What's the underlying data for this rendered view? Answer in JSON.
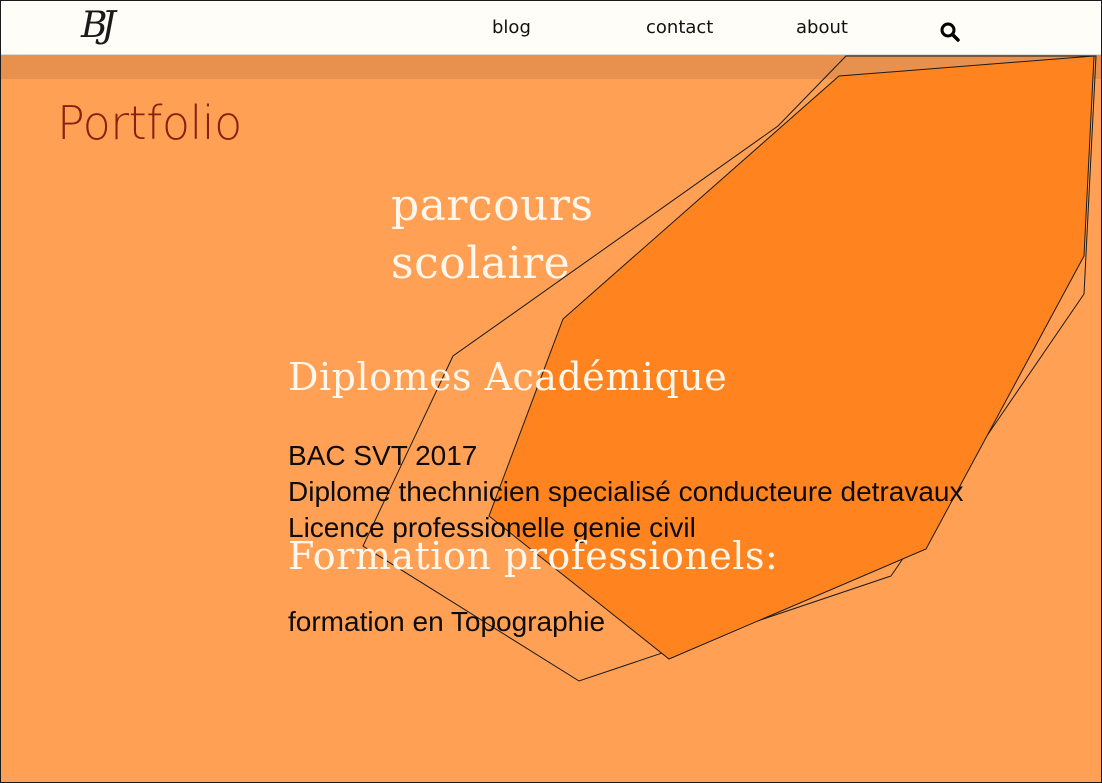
{
  "header": {
    "logo_text": "BJ",
    "nav": {
      "blog": "blog",
      "contact": "contact",
      "about": "about"
    },
    "search_icon": "search-icon"
  },
  "main": {
    "page_title": "Portfolio",
    "section_title": "parcours scolaire",
    "diplomes": {
      "heading": "Diplomes Académique",
      "items": [
        "BAC SVT 2017",
        "Diplome thechnicien specialisé conducteure detravaux",
        "Licence professionelle genie civil"
      ]
    },
    "formation": {
      "heading": "Formation professionels:",
      "items": [
        "formation en Topographie"
      ]
    }
  },
  "colors": {
    "background": "#ffa055",
    "shape_fill": "#ff8420",
    "title": "#8b1f10",
    "heading": "#fff7ec",
    "header_bg": "#fffdf8"
  }
}
